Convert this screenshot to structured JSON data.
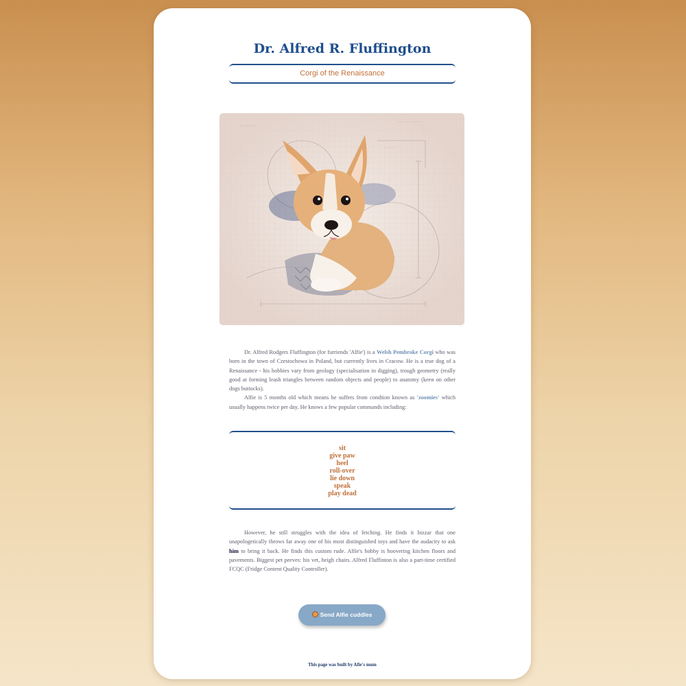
{
  "page": {
    "title": "Dr. Alfred R. Fluffington",
    "subtitle": "Corgi of the Renaissance"
  },
  "portrait": {
    "subject": "corgi puppy watercolor sketch"
  },
  "intro": {
    "p1_start": "Dr. Alfred Rodgers Fluffington (for furriends 'Alfie') is a ",
    "p1_link": "Welsh Pembroke Corgi",
    "p1_end": " who was born in the town of Czestochowa in Poland, but currently lives in Cracow. He is a true dog of a Renaissance - his hobbies vary from geology (specialisation in digging), trough geometry (really good at forming leash triangles between random objects and people) to anatomy (keen on other dogs buttocks).",
    "p2_start": "Alfie is 5 months old which means he suffers from condtion known as ",
    "p2_highlight": "'zoomies'",
    "p2_end": " which usually happens twice per day. He knows a few popular commands including:"
  },
  "commands": [
    "sit",
    "give paw",
    "heel",
    "roll-over",
    "lie down",
    "speak",
    "play dead"
  ],
  "outro": {
    "start": "However, he still struggles with the idea of fetching. He finds it bizzar that one unapologetically throws far away one of his most distinguished toys and have the audacity to ask ",
    "emphasis": "him",
    "end": " to bring it back. He finds this custom rude. Alfie's hobby is hoovering kitchen floors and pavements. Biggest pet peeves: his vet, heigh chairs. Alfred Fluffinton is also a part-time certified FCQC (Fridge Content Quality Controller)."
  },
  "button": {
    "icon": "star-struck-emoji-icon",
    "label": "Send Alfie cuddles"
  },
  "footer": {
    "text": "This page was built by Afie's mum"
  },
  "colors": {
    "title": "#1f4e8c",
    "accent": "#c0703a",
    "link": "#6f8fb5",
    "button": "#87a8c7"
  }
}
